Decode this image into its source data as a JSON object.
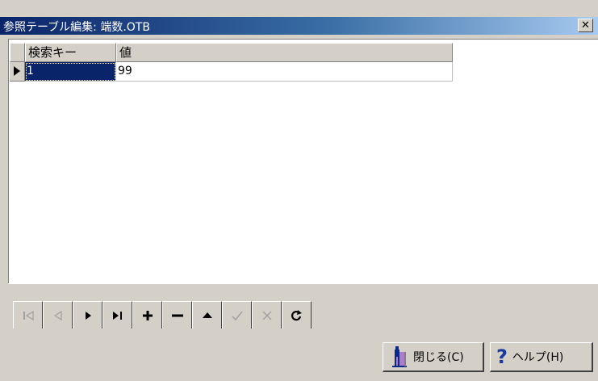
{
  "window": {
    "title": "参照テーブル編集: 端数.OTB",
    "close_glyph": "✕"
  },
  "grid": {
    "columns": [
      "検索キー",
      "値"
    ],
    "rows": [
      {
        "key": "1",
        "value": "99"
      }
    ]
  },
  "navigator": {
    "buttons": [
      {
        "name": "first-record",
        "enabled": false
      },
      {
        "name": "prior-record",
        "enabled": false
      },
      {
        "name": "next-record",
        "enabled": true
      },
      {
        "name": "last-record",
        "enabled": true
      },
      {
        "name": "insert-record",
        "enabled": true
      },
      {
        "name": "delete-record",
        "enabled": true
      },
      {
        "name": "edit-record",
        "enabled": true
      },
      {
        "name": "post-record",
        "enabled": false
      },
      {
        "name": "cancel-edit",
        "enabled": false
      },
      {
        "name": "refresh-data",
        "enabled": true
      }
    ]
  },
  "footer": {
    "close_label": "閉じる(C)",
    "help_label": "ヘルプ(H)"
  },
  "colors": {
    "titlebar_start": "#0a246a",
    "titlebar_end": "#a6caf0",
    "selection": "#0a246a",
    "face": "#d4d0c8"
  }
}
